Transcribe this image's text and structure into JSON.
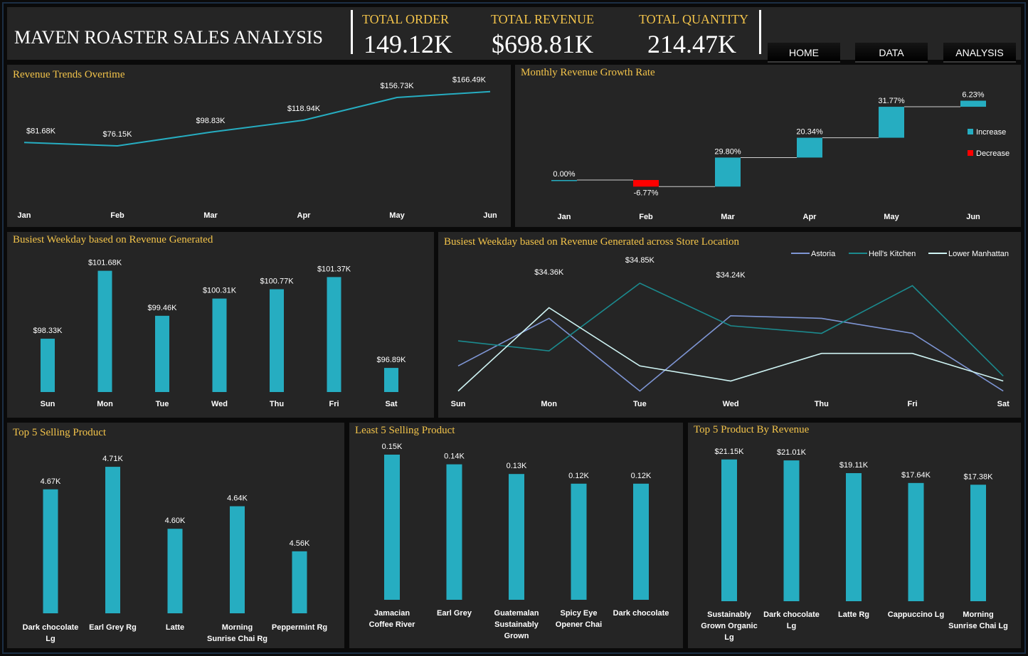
{
  "header": {
    "title": "MAVEN ROASTER SALES ANALYSIS",
    "kpis": [
      {
        "label": "TOTAL ORDER",
        "value": "149.12K"
      },
      {
        "label": "TOTAL REVENUE",
        "value": "$698.81K"
      },
      {
        "label": "TOTAL QUANTITY",
        "value": "214.47K"
      }
    ],
    "nav": [
      "HOME",
      "DATA",
      "ANALYSIS"
    ]
  },
  "colors": {
    "accent": "#26adc1",
    "decrease": "#ff0000",
    "title": "#f2c34a",
    "panel": "#252525",
    "astoria": "#7e95d4",
    "hells_kitchen": "#1b8a8e",
    "lower_manhattan": "#cff4f4"
  },
  "chart_data": [
    {
      "id": "revenue_trend",
      "type": "line",
      "title": "Revenue Trends Overtime",
      "categories": [
        "Jan",
        "Feb",
        "Mar",
        "Apr",
        "May",
        "Jun"
      ],
      "values": [
        81.68,
        76.15,
        98.83,
        118.94,
        156.73,
        166.49
      ],
      "labels": [
        "$81.68K",
        "$76.15K",
        "$98.83K",
        "$118.94K",
        "$156.73K",
        "$166.49K"
      ]
    },
    {
      "id": "growth_rate",
      "type": "bar",
      "subtype": "waterfall",
      "title": "Monthly Revenue Growth Rate",
      "categories": [
        "Jan",
        "Feb",
        "Mar",
        "Apr",
        "May",
        "Jun"
      ],
      "values": [
        0.0,
        -6.77,
        29.8,
        20.34,
        31.77,
        6.23
      ],
      "labels": [
        "0.00%",
        "-6.77%",
        "29.80%",
        "20.34%",
        "31.77%",
        "6.23%"
      ],
      "legend": [
        "Increase",
        "Decrease"
      ],
      "legend_position": "right"
    },
    {
      "id": "weekday_revenue",
      "type": "bar",
      "title": "Busiest Weekday based on Revenue Generated",
      "categories": [
        "Sun",
        "Mon",
        "Tue",
        "Wed",
        "Thu",
        "Fri",
        "Sat"
      ],
      "values": [
        98.33,
        101.68,
        99.46,
        100.31,
        100.77,
        101.37,
        96.89
      ],
      "labels": [
        "$98.33K",
        "$101.68K",
        "$99.46K",
        "$100.31K",
        "$100.77K",
        "$101.37K",
        "$96.89K"
      ]
    },
    {
      "id": "weekday_store",
      "type": "line",
      "title": "Busiest Weekday based on Revenue Generated across Store Location",
      "categories": [
        "Sun",
        "Mon",
        "Tue",
        "Wed",
        "Thu",
        "Fri",
        "Sat"
      ],
      "series": [
        {
          "name": "Astoria",
          "values": [
            33.2,
            34.15,
            32.7,
            34.2,
            34.15,
            33.85,
            32.7
          ]
        },
        {
          "name": "Hell's Kitchen",
          "values": [
            33.7,
            33.5,
            34.85,
            34.0,
            33.85,
            34.8,
            33.0
          ]
        },
        {
          "name": "Lower Manhattan",
          "values": [
            32.7,
            34.36,
            33.2,
            32.9,
            33.45,
            33.45,
            32.9
          ]
        }
      ],
      "annotations": [
        "$34.36K",
        "$34.85K",
        "$34.24K"
      ],
      "legend_position": "top-right"
    },
    {
      "id": "top5_selling",
      "type": "bar",
      "title": "Top 5 Selling Product",
      "categories": [
        "Dark chocolate Lg",
        "Earl Grey Rg",
        "Latte",
        "Morning Sunrise Chai Rg",
        "Peppermint Rg"
      ],
      "values": [
        4.67,
        4.71,
        4.6,
        4.64,
        4.56
      ],
      "labels": [
        "4.67K",
        "4.71K",
        "4.60K",
        "4.64K",
        "4.56K"
      ]
    },
    {
      "id": "least5_selling",
      "type": "bar",
      "title": "Least 5 Selling Product",
      "categories": [
        "Jamacian Coffee River",
        "Earl Grey",
        "Guatemalan Sustainably Grown",
        "Spicy Eye Opener Chai",
        "Dark chocolate"
      ],
      "values": [
        0.15,
        0.14,
        0.13,
        0.12,
        0.12
      ],
      "labels": [
        "0.15K",
        "0.14K",
        "0.13K",
        "0.12K",
        "0.12K"
      ]
    },
    {
      "id": "top5_revenue",
      "type": "bar",
      "title": "Top 5 Product By Revenue",
      "categories": [
        "Sustainably Grown Organic Lg",
        "Dark chocolate Lg",
        "Latte Rg",
        "Cappuccino Lg",
        "Morning Sunrise Chai Lg"
      ],
      "values": [
        21.15,
        21.01,
        19.11,
        17.64,
        17.38
      ],
      "labels": [
        "$21.15K",
        "$21.01K",
        "$19.11K",
        "$17.64K",
        "$17.38K"
      ]
    }
  ]
}
